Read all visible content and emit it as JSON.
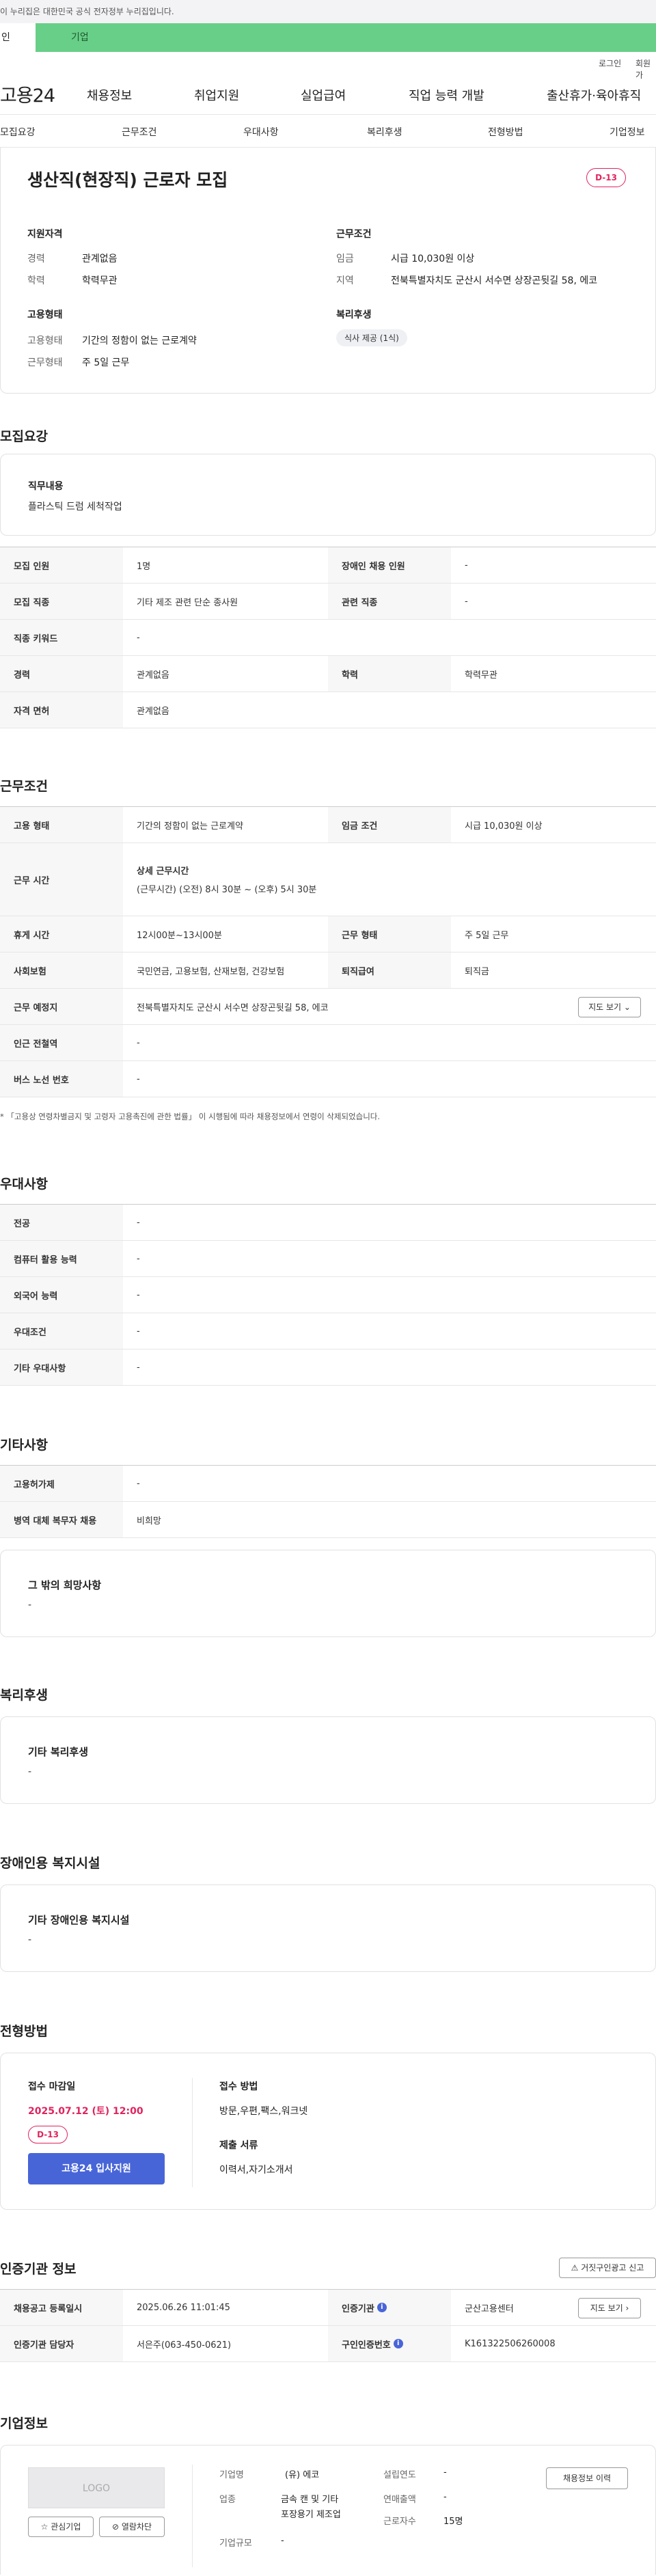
{
  "gov_banner": "이 누리집은 대한민국 공식 전자정부 누리집입니다.",
  "tabs": {
    "a": "인",
    "b": "기업"
  },
  "util": {
    "login": "로그인",
    "join": "회원가"
  },
  "logo": "고용24",
  "gnb": [
    "채용정보",
    "취업지원",
    "실업급여",
    "직업 능력 개발",
    "출산휴가·육아휴직"
  ],
  "lnb": [
    "모집요강",
    "근무조건",
    "우대사항",
    "복리후생",
    "전형방법",
    "기업정보"
  ],
  "job": {
    "title": "생산직(현장직) 근로자 모집",
    "dday": "D-13"
  },
  "summary": {
    "qual_title": "지원자격",
    "career_k": "경력",
    "career_v": "관계없음",
    "edu_k": "학력",
    "edu_v": "학력무관",
    "emp_title": "고용형태",
    "type_k": "고용형태",
    "type_v": "기간의 정함이 없는 근로계약",
    "days_k": "근무형태",
    "days_v": "주 5일 근무",
    "cond_title": "근무조건",
    "wage_k": "임금",
    "wage_v": "시급 10,030원 이상",
    "area_k": "지역",
    "area_v": "전북특별자치도 군산시 서수면 상장곤뒷길 58, 에코",
    "welfare_title": "복리후생",
    "welfare_pill": "식사 제공 (1식)"
  },
  "s_recruit": {
    "title": "모집요강",
    "duty_k": "직무내용",
    "duty_v": "플라스틱 드럼 세척작업",
    "rows": [
      [
        "모집 인원",
        "1명",
        "장애인 채용 인원",
        "-"
      ],
      [
        "모집 직종",
        "기타 제조 관련 단순 종사원",
        "관련 직종",
        "-"
      ],
      [
        "직종 키워드",
        "-"
      ],
      [
        "경력",
        "관계없음",
        "학력",
        "학력무관"
      ],
      [
        "자격 면허",
        "관계없음"
      ]
    ]
  },
  "s_cond": {
    "title": "근무조건",
    "r1": [
      "고용 형태",
      "기간의 정함이 없는 근로계약",
      "임금 조건",
      "시급 10,030원 이상"
    ],
    "r2": [
      "근무 시간",
      "상세 근무시간",
      "(근무시간) (오전) 8시 30분 ~ (오후) 5시 30분"
    ],
    "r3": [
      "휴게 시간",
      "12시00분~13시00분",
      "근무 형태",
      "주 5일 근무"
    ],
    "r4": [
      "사회보험",
      "국민연금, 고용보험, 산재보험, 건강보험",
      "퇴직급여",
      "퇴직금"
    ],
    "r5": [
      "근무 예정지",
      "전북특별자치도 군산시 서수면 상장곤뒷길 58, 에코",
      "지도 보기"
    ],
    "r6": [
      "인근 전철역",
      "-"
    ],
    "r7": [
      "버스 노선 번호",
      "-"
    ],
    "note": "* 「고용상 연령차별금지 및 고령자 고용촉진에 관한 법률」 이 시행됨에 따라 채용정보에서 연령이 삭제되었습니다."
  },
  "s_pref": {
    "title": "우대사항",
    "rows": [
      [
        "전공",
        "-"
      ],
      [
        "컴퓨터 활용 능력",
        "-"
      ],
      [
        "외국어 능력",
        "-"
      ],
      [
        "우대조건",
        "-"
      ],
      [
        "기타 우대사항",
        "-"
      ]
    ]
  },
  "s_etc": {
    "title": "기타사항",
    "rows": [
      [
        "고용허가제",
        "-"
      ],
      [
        "병역 대체 복무자 채용",
        "비희망"
      ]
    ],
    "box_t": "그 밖의 희망사항",
    "box_v": "-"
  },
  "s_welfare": {
    "title": "복리후생",
    "box_t": "기타 복리후생",
    "box_v": "-"
  },
  "s_disab": {
    "title": "장애인용 복지시설",
    "box_t": "기타 장애인용 복지시설",
    "box_v": "-"
  },
  "s_proc": {
    "title": "전형방법",
    "deadline_t": "접수 마감일",
    "deadline_v": "2025.07.12 (토) 12:00",
    "dday": "D-13",
    "apply": "고용24 입사지원",
    "method_t": "접수 방법",
    "method_v": "방문,우편,팩스,워크넷",
    "docs_t": "제출 서류",
    "docs_v": "이력서,자기소개서"
  },
  "s_cert": {
    "title": "인증기관 정보",
    "report": "거짓구인광고 신고",
    "r1": [
      "채용공고 등록일시",
      "2025.06.26 11:01:45",
      "인증기관",
      "군산고용센터",
      "지도 보기"
    ],
    "r2": [
      "인증기관 담당자",
      "서은주(063-450-0621)",
      "구인인증번호",
      "K161322506260008"
    ]
  },
  "s_company": {
    "title": "기업정보",
    "logo": "LOGO",
    "fav": "관심기업",
    "block": "열람차단",
    "history": "채용정보 이력",
    "name_k": "기업명",
    "name_v": "(유) 에코",
    "year_k": "설립연도",
    "year_v": "-",
    "ind_k": "업종",
    "ind_v1": "금속 캔 및 기타",
    "ind_v2": "포장용기 제조업",
    "sales_k": "연매출액",
    "sales_v": "-",
    "size_k": "기업규모",
    "size_v": "-",
    "emp_k": "근로자수",
    "emp_v": "15명"
  },
  "colors": {
    "green": "#68cf88",
    "accent": "#e0245e",
    "blue": "#4865d8"
  }
}
